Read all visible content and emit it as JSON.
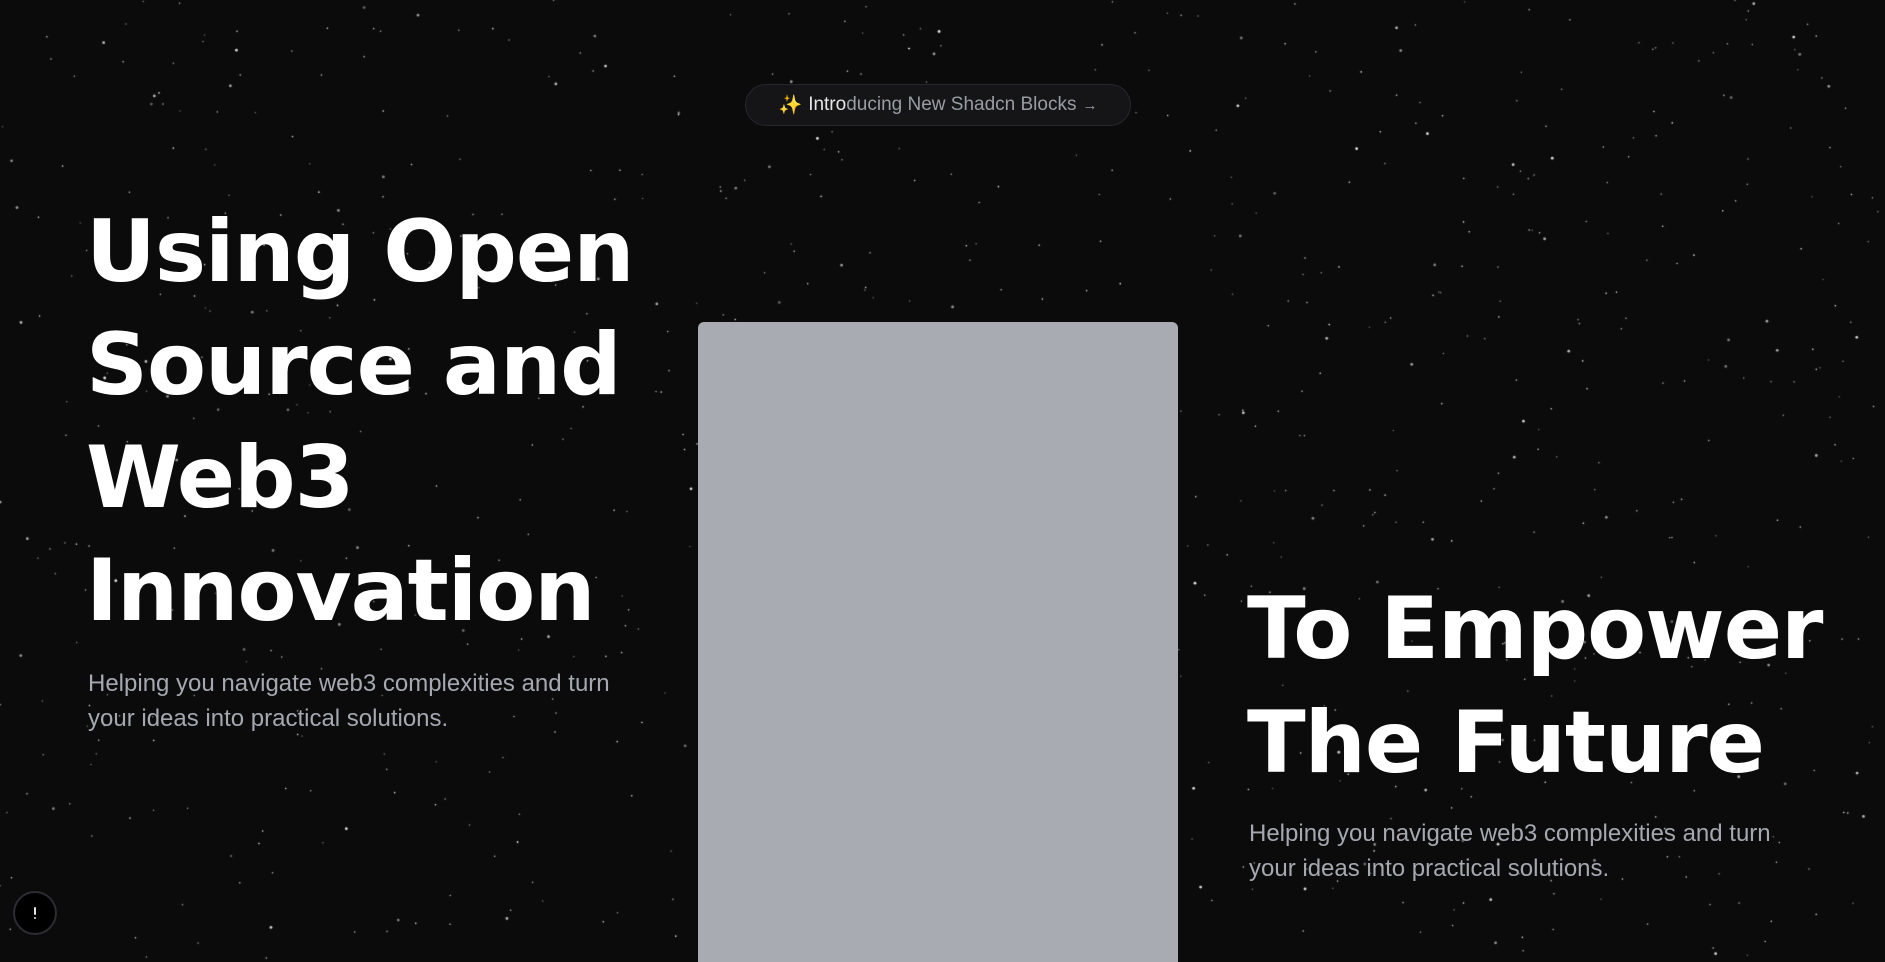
{
  "announcement": {
    "icon": "sparkles-icon",
    "label_highlight": "Intro",
    "label_rest": "ducing New Shadcn Blocks",
    "arrow": "→"
  },
  "hero_left": {
    "title_lines": [
      "Using Open",
      "Source and",
      "Web3",
      "Innovation"
    ],
    "subtext": "Helping you navigate web3 complexities and turn your ideas into practical solutions."
  },
  "hero_right": {
    "title_lines": [
      "To Empower",
      "The Future"
    ],
    "subtext": "Helping you navigate web3 complexities and turn your ideas into practical solutions."
  },
  "colors": {
    "background": "#0b0b0c",
    "panel": "#a9abb3",
    "heading": "#ffffff",
    "subtext": "#a5a8b0",
    "accent_sparkle": "#e7b94c"
  },
  "floating_button": {
    "icon": "alert-icon"
  }
}
